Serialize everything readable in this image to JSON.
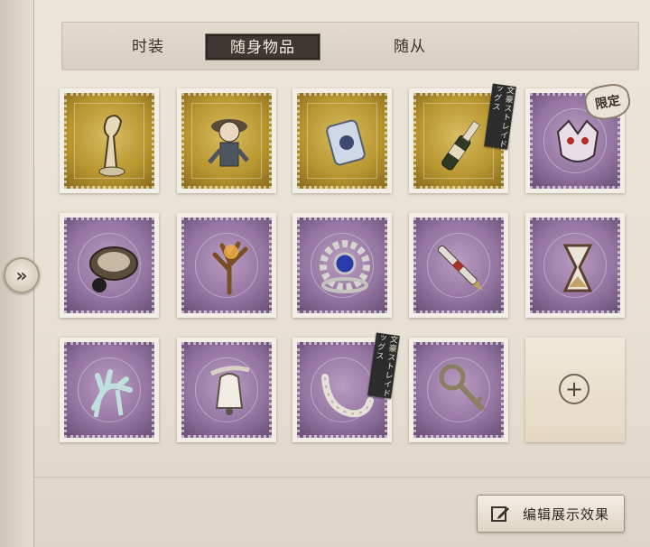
{
  "tabs": [
    {
      "label": "时装",
      "active": false
    },
    {
      "label": "随身物品",
      "active": true
    },
    {
      "label": "随从",
      "active": false
    }
  ],
  "items": [
    {
      "icon": "bird-vase-icon",
      "frame": "gold",
      "badge": null
    },
    {
      "icon": "doll-figure-icon",
      "frame": "gold",
      "badge": null
    },
    {
      "icon": "glass-jar-icon",
      "frame": "gold",
      "badge": null
    },
    {
      "icon": "champagne-bottle-icon",
      "frame": "gold",
      "badge": "文豪ストレイドッグス"
    },
    {
      "icon": "demon-mask-icon",
      "frame": "purple",
      "badge": "限定"
    },
    {
      "icon": "music-box-icon",
      "frame": "purple",
      "badge": null
    },
    {
      "icon": "antler-lamp-icon",
      "frame": "purple",
      "badge": null
    },
    {
      "icon": "gear-ring-icon",
      "frame": "purple",
      "badge": null
    },
    {
      "icon": "fountain-pen-icon",
      "frame": "purple",
      "badge": null
    },
    {
      "icon": "hourglass-icon",
      "frame": "purple",
      "badge": null
    },
    {
      "icon": "deer-ornament-icon",
      "frame": "purple",
      "badge": null
    },
    {
      "icon": "bell-icon",
      "frame": "purple",
      "badge": null
    },
    {
      "icon": "bone-tail-icon",
      "frame": "purple",
      "badge": "文豪ストレイドッグス"
    },
    {
      "icon": "ornate-key-icon",
      "frame": "purple",
      "badge": null
    }
  ],
  "add_slot": {
    "icon": "plus-icon",
    "symbol": "+"
  },
  "collapse_button": {
    "icon": "double-chevron-right-icon",
    "symbol": "»"
  },
  "edit_button": {
    "label": "编辑展示效果",
    "icon": "edit-icon"
  }
}
